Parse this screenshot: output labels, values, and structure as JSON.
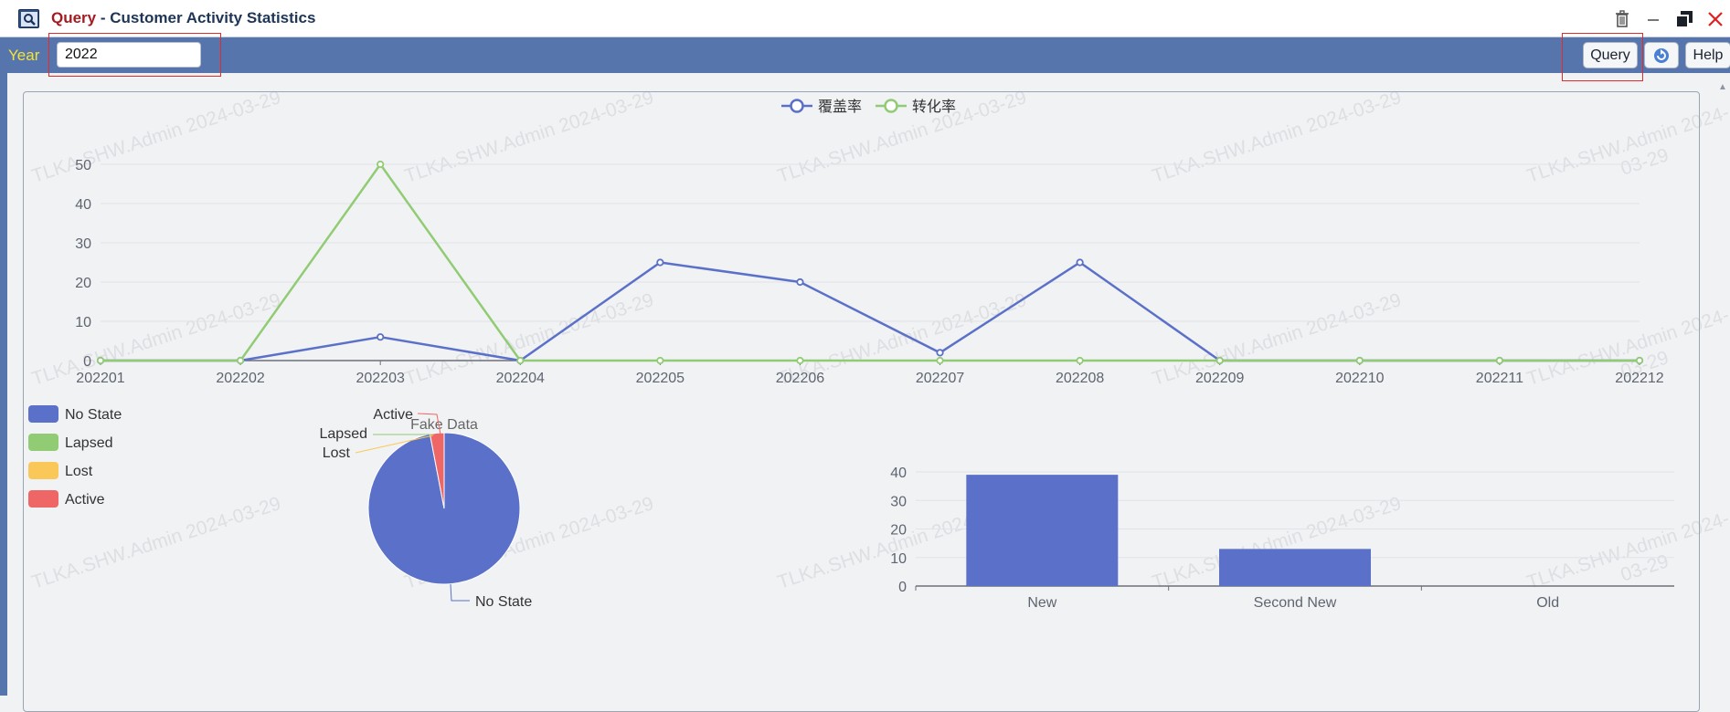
{
  "window": {
    "title_prefix": "Query",
    "title_separator": " - ",
    "title_main": "Customer Activity Statistics"
  },
  "toolbar": {
    "year_label": "Year",
    "year_value": "2022",
    "query_label": "Query",
    "help_label": "Help"
  },
  "watermark": {
    "text": "TLKA.SHW.Admin 2024-03-29",
    "text_wrap_top": "TLKA.SHW.Admin 2024-",
    "text_wrap_bottom": "03-29"
  },
  "icons": {
    "app": "search-icon",
    "trash": "trash-icon",
    "minimize": "minimize-icon",
    "restore": "restore-icon",
    "close": "close-icon",
    "refresh": "refresh-icon"
  },
  "colors": {
    "toolbar": "#5775ad",
    "year_label": "#f3e339",
    "title_accent": "#a31c22",
    "close": "#e02020",
    "series_blue": "#5b70c8",
    "series_green": "#91cc75",
    "pie_lost": "#fac858",
    "pie_active": "#ee6666"
  },
  "chart_data": [
    {
      "type": "line",
      "x": [
        "202201",
        "202202",
        "202203",
        "202204",
        "202205",
        "202206",
        "202207",
        "202208",
        "202209",
        "202210",
        "202211",
        "202212"
      ],
      "series": [
        {
          "name": "覆盖率",
          "color": "#5b70c8",
          "values": [
            0,
            0,
            6,
            0,
            25,
            20,
            2,
            25,
            0,
            0,
            0,
            0
          ]
        },
        {
          "name": "转化率",
          "color": "#91cc75",
          "values": [
            0,
            0,
            50,
            0,
            0,
            0,
            0,
            0,
            0,
            0,
            0,
            0
          ]
        }
      ],
      "yticks": [
        0,
        10,
        20,
        30,
        40,
        50
      ],
      "ylim": [
        0,
        50
      ],
      "legend": "top-center",
      "grid": true
    },
    {
      "type": "pie",
      "title": "Fake Data",
      "slices": [
        {
          "label": "No State",
          "value": 97,
          "color": "#5b70c8"
        },
        {
          "label": "Lapsed",
          "value": 0,
          "color": "#91cc75"
        },
        {
          "label": "Lost",
          "value": 0,
          "color": "#fac858"
        },
        {
          "label": "Active",
          "value": 3,
          "color": "#ee6666"
        }
      ],
      "legend": "left"
    },
    {
      "type": "bar",
      "categories": [
        "New",
        "Second New",
        "Old"
      ],
      "values": [
        39,
        13,
        0
      ],
      "color": "#5b70c8",
      "yticks": [
        0,
        10,
        20,
        30,
        40
      ],
      "ylim": [
        0,
        40
      ],
      "grid": true
    }
  ]
}
